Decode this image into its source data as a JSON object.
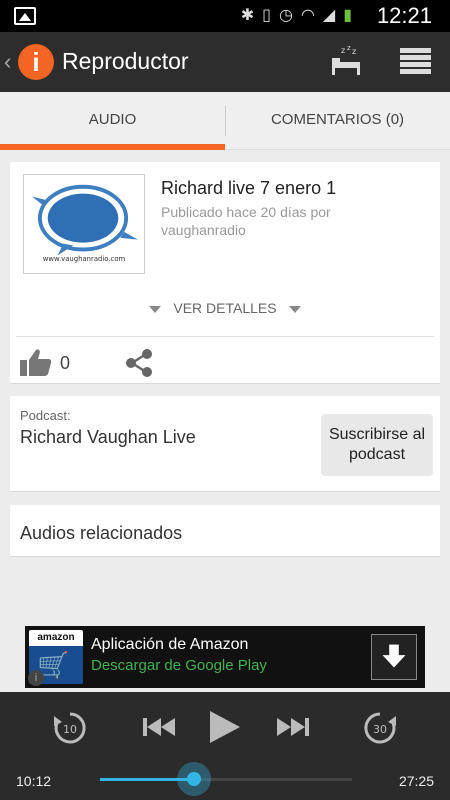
{
  "status_bar": {
    "time": "12:21",
    "icons": [
      "image-icon",
      "bluetooth-icon",
      "vibrate-icon",
      "alarm-icon",
      "wifi-icon",
      "signal-icon",
      "battery-icon"
    ]
  },
  "app_bar": {
    "title": "Reproductor",
    "accent_color": "#f26522",
    "logo_glyph": "i"
  },
  "tabs": [
    {
      "label": "AUDIO",
      "active": true
    },
    {
      "label": "COMENTARIOS (0)",
      "active": false
    }
  ],
  "episode": {
    "title": "Richard live 7 enero 1",
    "meta": "Publicado hace 20 días por vaughanradio",
    "thumbnail_url_text": "www.vaughanradio.com",
    "details_label": "VER DETALLES",
    "likes": "0"
  },
  "podcast": {
    "label": "Podcast:",
    "name": "Richard Vaughan Live",
    "subscribe_label": "Suscribirse al podcast"
  },
  "related": {
    "label": "Audios relacionados"
  },
  "ad": {
    "brand": "amazon",
    "title": "Aplicación de Amazon",
    "subtitle": "Descargar de Google Play",
    "info_glyph": "i"
  },
  "player": {
    "rewind_seconds": "10",
    "forward_seconds": "30",
    "current_time": "10:12",
    "total_time": "27:25",
    "progress": 0.372,
    "accent_color": "#33b5e5"
  }
}
